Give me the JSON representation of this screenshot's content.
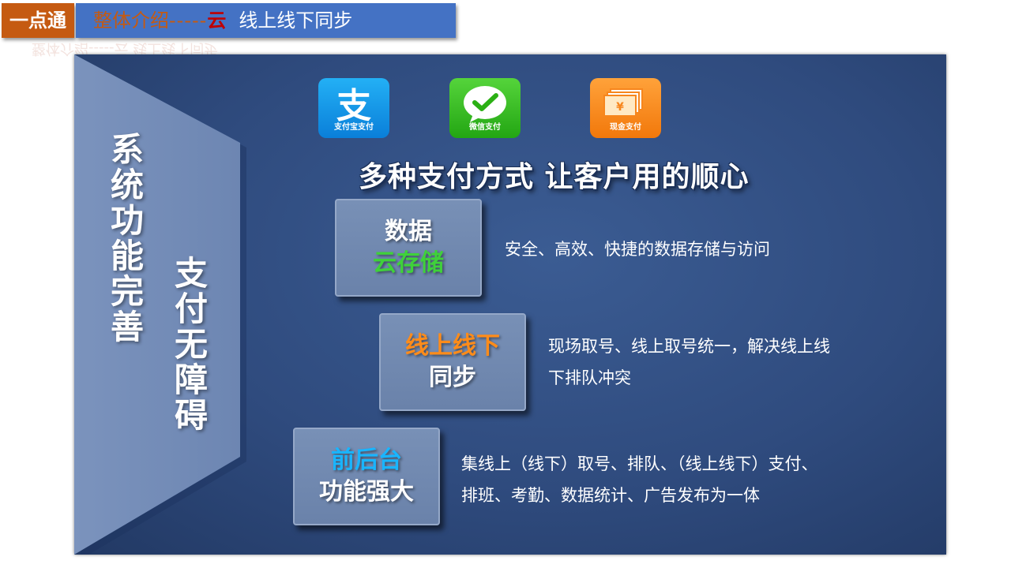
{
  "header": {
    "tag": "一点通",
    "part1": "整体介绍",
    "dashes": "-----",
    "cloud": "云",
    "rest": "线上线下同步"
  },
  "side": {
    "col1": "系统功能完善",
    "col2": "支付无障碍"
  },
  "payments": [
    {
      "label": "支付宝支付",
      "icon": "alipay-icon",
      "color": "#1296db"
    },
    {
      "label": "微信支付",
      "icon": "wechat-icon",
      "color": "#2bb014"
    },
    {
      "label": "现金支付",
      "icon": "cash-icon",
      "color": "#f7861d"
    }
  ],
  "slogan": "多种支付方式 让客户用的顺心",
  "features": [
    {
      "line1": "数据",
      "line2": "云存储",
      "desc1": "安全、高效、快捷的数据存储与访问",
      "desc2": ""
    },
    {
      "line1": "线上线下",
      "line2": "同步",
      "desc1": "现场取号、线上取号统一，解决线上线",
      "desc2": "下排队冲突"
    },
    {
      "line1": "前后台",
      "line2": "功能强大",
      "desc1": "集线上（线下）取号、排队、（线上线下）支付、",
      "desc2": "排班、考勤、数据统计、广告发布为一体"
    }
  ],
  "colors": {
    "header_tag": "#c55a11",
    "header_bar": "#4472c4",
    "panel": "#2f4b7e",
    "accent_green": "#3fd13a",
    "accent_orange": "#ff8c1a",
    "accent_blue": "#19b5ff"
  }
}
